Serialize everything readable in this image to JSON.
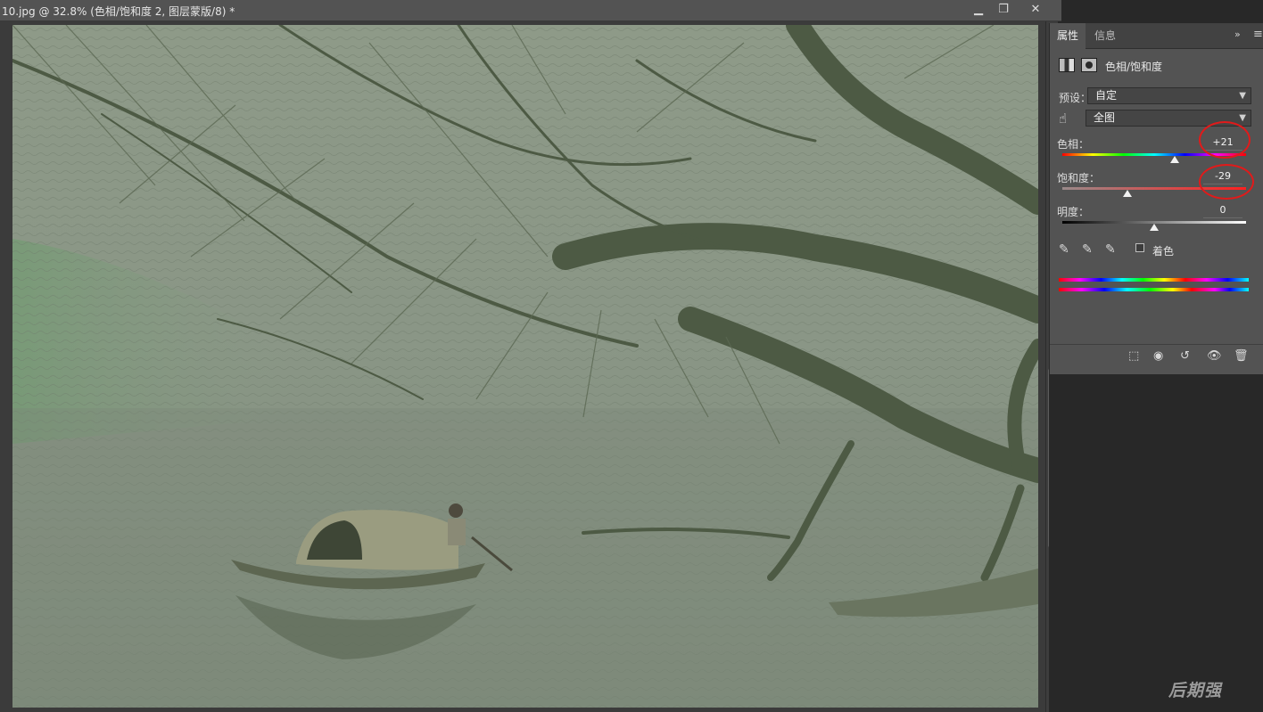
{
  "document": {
    "title": "10.jpg @ 32.8% (色相/饱和度 2, 图层蒙版/8) *",
    "window_controls": {
      "minimize": "▁",
      "restore": "❐",
      "close": "✕"
    }
  },
  "panel": {
    "tabs": [
      {
        "label": "属性",
        "active": true
      },
      {
        "label": "信息",
        "active": false
      }
    ],
    "collapse_glyph": "»",
    "menu_glyph": "≡",
    "adjustment_title": "色相/饱和度",
    "preset": {
      "label": "预设：",
      "value": "自定"
    },
    "channel": {
      "value": "全图"
    },
    "hue": {
      "label": "色相：",
      "value": "+21",
      "slider_fraction": 0.61
    },
    "saturation": {
      "label": "饱和度：",
      "value": "-29",
      "slider_fraction": 0.355
    },
    "lightness": {
      "label": "明度：",
      "value": "0",
      "slider_fraction": 0.5
    },
    "colorize": {
      "label": "着色",
      "checked": false
    },
    "highlight_color": "#e11a1a"
  },
  "watermark": "后期强"
}
